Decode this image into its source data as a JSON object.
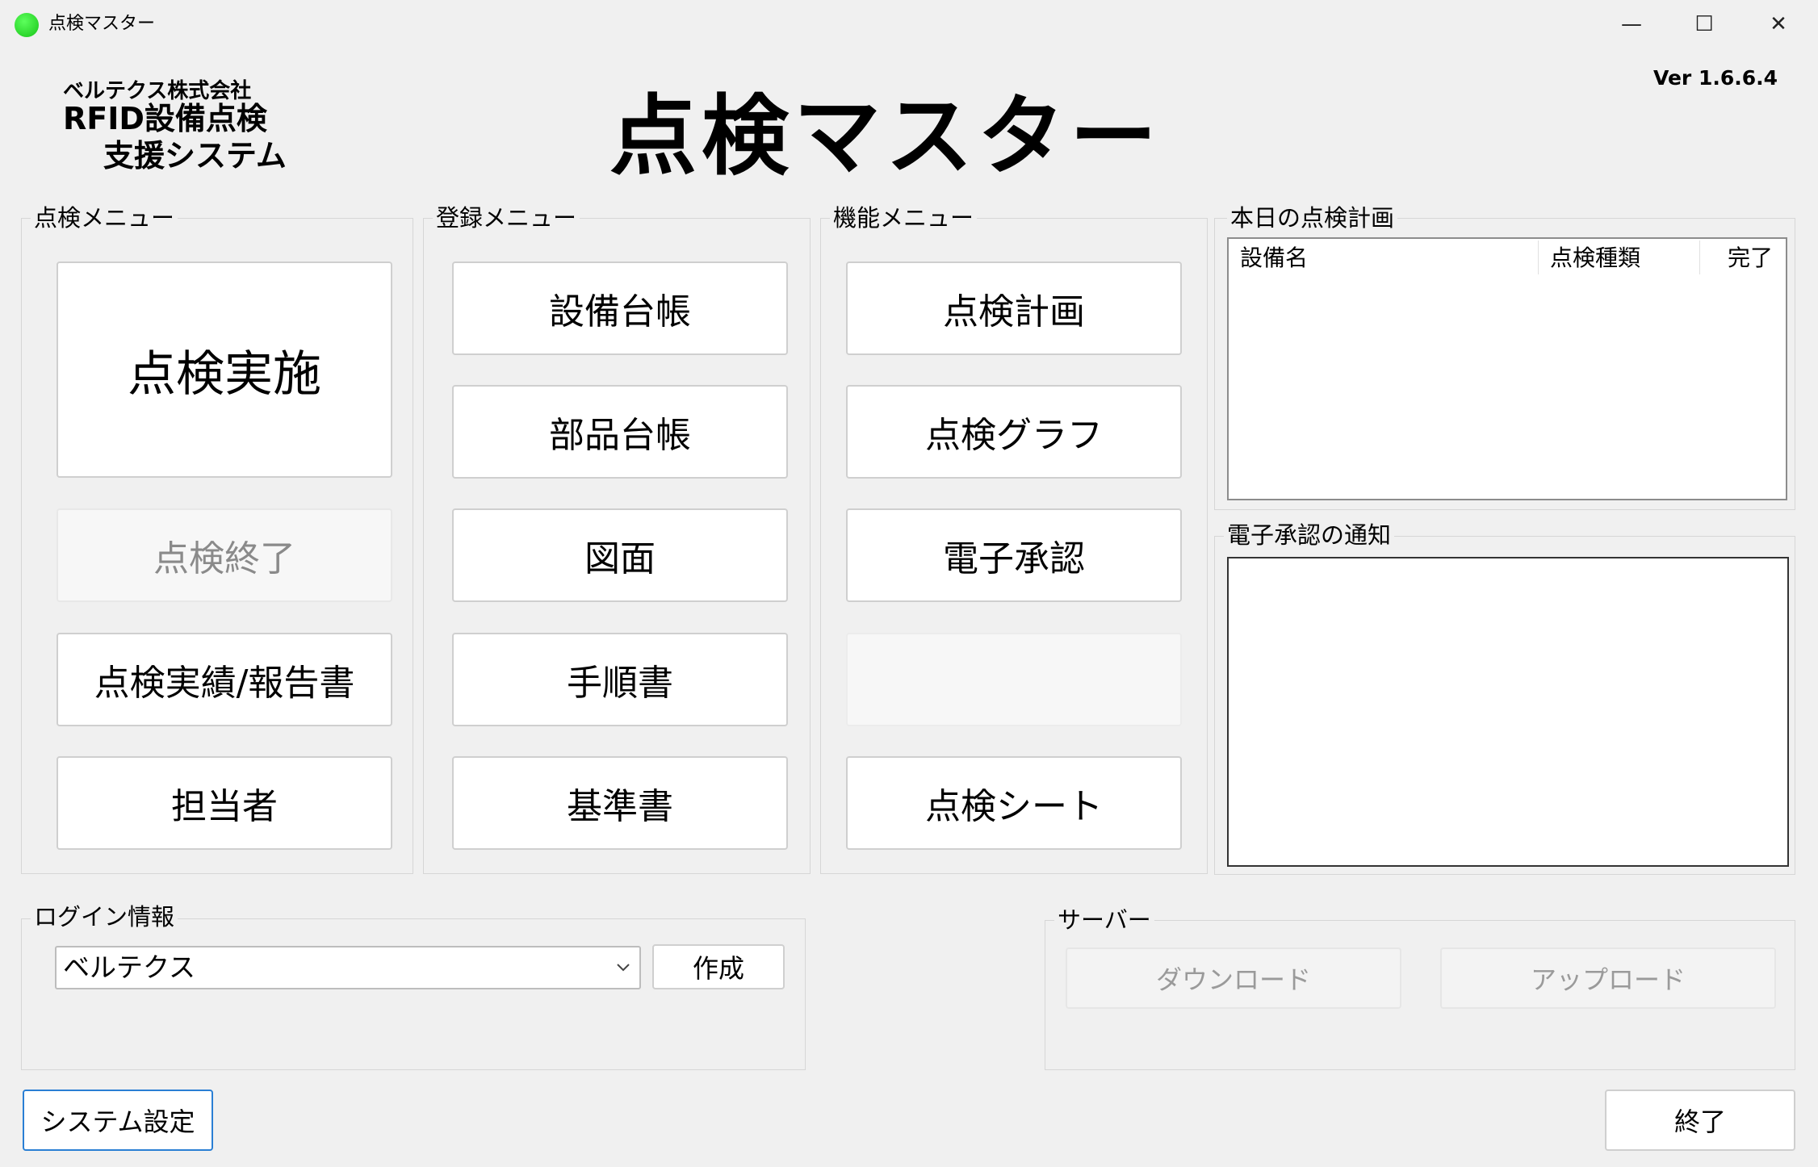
{
  "window": {
    "title": "点検マスター",
    "controls": {
      "minimize": "—",
      "maximize": "☐",
      "close": "✕"
    },
    "accent_color": "#21c021"
  },
  "header": {
    "company": "ベルテクス株式会社",
    "product_line1": "RFID設備点検",
    "product_line2": "支援システム",
    "app_title": "点検マスター",
    "version": "Ver 1.6.6.4"
  },
  "inspection_menu": {
    "label": "点検メニュー",
    "start_label": "点検実施",
    "end_label": "点検終了",
    "results_label": "点検実績/報告書",
    "staff_label": "担当者"
  },
  "registration_menu": {
    "label": "登録メニュー",
    "equipment_ledger": "設備台帳",
    "parts_ledger": "部品台帳",
    "drawings": "図面",
    "procedures": "手順書",
    "standards": "基準書"
  },
  "function_menu": {
    "label": "機能メニュー",
    "plan": "点検計画",
    "graph": "点検グラフ",
    "approval": "電子承認",
    "sheet": "点検シート"
  },
  "today_plan": {
    "label": "本日の点検計画",
    "columns": [
      "設備名",
      "点検種類",
      "完了"
    ]
  },
  "approval_notice": {
    "label": "電子承認の通知"
  },
  "login": {
    "label": "ログイン情報",
    "selected_user": "ベルテクス",
    "create_label": "作成"
  },
  "server": {
    "label": "サーバー",
    "download_label": "ダウンロード",
    "upload_label": "アップロード"
  },
  "footer": {
    "settings_label": "システム設定",
    "exit_label": "終了"
  }
}
